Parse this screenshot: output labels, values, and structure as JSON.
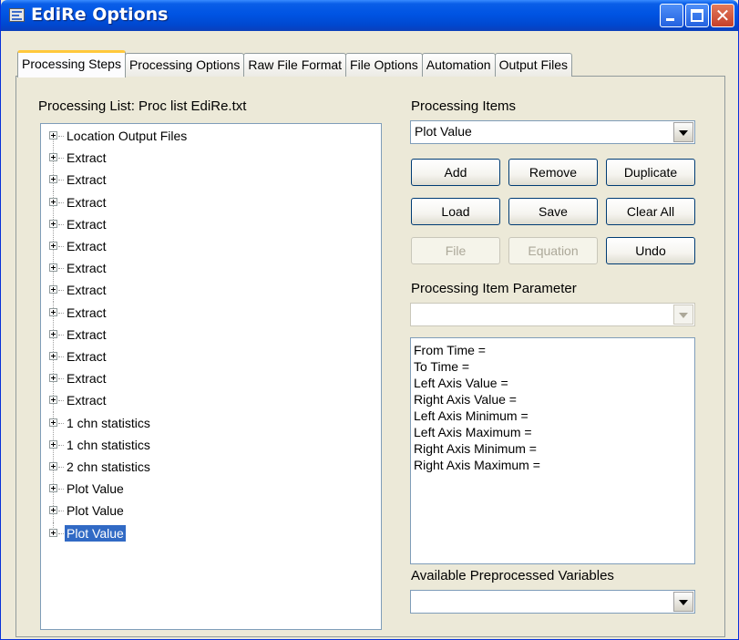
{
  "window": {
    "title": "EdiRe Options",
    "icons": [
      "app-icon",
      "minimize-icon",
      "maximize-icon",
      "close-icon"
    ],
    "accent_color": "#0054e3"
  },
  "tabs": [
    {
      "label": "Processing Steps",
      "active": true
    },
    {
      "label": "Processing Options",
      "active": false
    },
    {
      "label": "Raw File Format",
      "active": false
    },
    {
      "label": "File Options",
      "active": false
    },
    {
      "label": "Automation",
      "active": false
    },
    {
      "label": "Output Files",
      "active": false
    }
  ],
  "processing_list": {
    "label": "Processing List: Proc list EdiRe.txt",
    "items": [
      {
        "label": "Location Output Files"
      },
      {
        "label": "Extract"
      },
      {
        "label": "Extract"
      },
      {
        "label": "Extract"
      },
      {
        "label": "Extract"
      },
      {
        "label": "Extract"
      },
      {
        "label": "Extract"
      },
      {
        "label": "Extract"
      },
      {
        "label": "Extract"
      },
      {
        "label": "Extract"
      },
      {
        "label": "Extract"
      },
      {
        "label": "Extract"
      },
      {
        "label": "Extract"
      },
      {
        "label": "1 chn statistics"
      },
      {
        "label": "1 chn statistics"
      },
      {
        "label": "2 chn statistics"
      },
      {
        "label": "Plot Value"
      },
      {
        "label": "Plot Value"
      },
      {
        "label": "Plot Value",
        "selected": true
      }
    ]
  },
  "processing_items": {
    "label": "Processing Items",
    "selected": "Plot Value"
  },
  "buttons": {
    "add": "Add",
    "remove": "Remove",
    "duplicate": "Duplicate",
    "load": "Load",
    "save": "Save",
    "clear_all": "Clear All",
    "file": "File",
    "equation": "Equation",
    "undo": "Undo"
  },
  "parameter": {
    "label": "Processing Item Parameter",
    "selected": "",
    "lines": [
      "From Time =",
      "To Time =",
      "Left Axis Value =",
      "Right Axis Value =",
      "Left Axis Minimum =",
      "Left Axis Maximum =",
      "Right Axis Minimum =",
      "Right Axis Maximum ="
    ]
  },
  "preprocessed": {
    "label": "Available Preprocessed Variables",
    "selected": ""
  }
}
